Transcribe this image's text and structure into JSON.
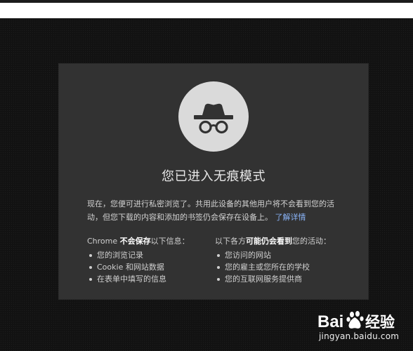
{
  "incognito_page": {
    "title": "您已进入无痕模式",
    "intro_text": "现在，您便可进行私密浏览了。共用此设备的其他用户将不会看到您的活动，但您下载的内容和添加的书签仍会保存在设备上。",
    "learn_more_link": "了解详情",
    "not_saved": {
      "prefix": "Chrome ",
      "emphasis": "不会保存",
      "suffix": "以下信息：",
      "items": [
        "您的浏览记录",
        "Cookie 和网站数据",
        "在表单中填写的信息"
      ]
    },
    "may_be_visible": {
      "prefix": "以下各方",
      "emphasis": "可能仍会看到",
      "suffix": "您的活动：",
      "items": [
        "您访问的网站",
        "您的雇主或您所在的学校",
        "您的互联网服务提供商"
      ]
    }
  },
  "watermark": {
    "logo_text": "Bai经验",
    "url": "jingyan.baidu.com"
  },
  "colors": {
    "background": "#121212",
    "card": "#323232",
    "icon_circle": "#dadada",
    "icon_glyph": "#323232",
    "link": "#8ab4f8",
    "text": "#d2d2d2"
  },
  "icons": {
    "incognito": "incognito-spy-icon",
    "watermark_paw": "baidu-paw-icon"
  }
}
